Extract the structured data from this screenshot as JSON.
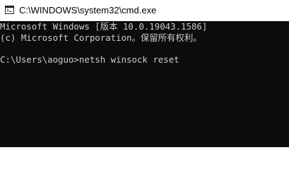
{
  "window": {
    "title": "C:\\WINDOWS\\system32\\cmd.exe",
    "icon": "cmd-icon",
    "colors": {
      "titlebar_background": "#ffffff",
      "console_background": "#0c0c0c",
      "console_text": "#cccccc"
    }
  },
  "console": {
    "lines": [
      "Microsoft Windows [版本 10.0.19043.1586]",
      "(c) Microsoft Corporation。保留所有权利。"
    ],
    "prompt": "C:\\Users\\aoguo>",
    "command": "netsh winsock reset"
  }
}
